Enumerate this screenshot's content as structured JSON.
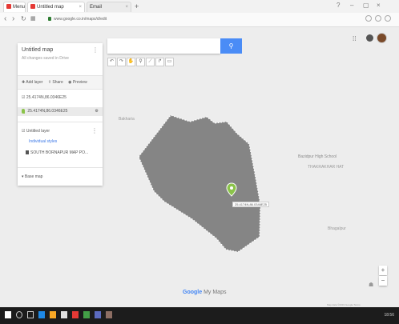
{
  "browser": {
    "tabs": [
      {
        "label": "Menu"
      },
      {
        "label": "Untitled map"
      },
      {
        "label": "Email"
      }
    ],
    "url": "www.google.co.in/maps/d/edit",
    "window_controls": [
      "?",
      "–",
      "▢",
      "×"
    ]
  },
  "map": {
    "search": {
      "value": "",
      "placeholder": ""
    },
    "panel": {
      "title": "Untitled map",
      "subtitle": "All changes saved in Drive",
      "actions": [
        "✚ Add layer",
        "⇪ Share",
        "◉ Preview"
      ],
      "layer1": {
        "name": "25.4174N,86.0346E25",
        "item": "25.4174N,86.0346E25"
      },
      "layer2": {
        "name": "Untitled layer",
        "import": "Individual styles",
        "item": "SOUTH BORNAPUR MAP PO..."
      },
      "basemap": "Base map"
    },
    "labels": {
      "area_left": "Bakharia",
      "school": "Bazidpur High School",
      "village": "THAKRAKHAR HAT",
      "village2": "Bhagalpur",
      "marker": "25.4174N,86.0346E25"
    },
    "branding": {
      "brand": "Google",
      "product": "My Maps"
    },
    "attribution": "Map data ©2019 Google  Terms"
  },
  "taskbar": {
    "clock": "18:56"
  },
  "colors": {
    "polygon_fill": "#858585",
    "accent": "#4a8cf6",
    "marker": "#8bc34a"
  }
}
